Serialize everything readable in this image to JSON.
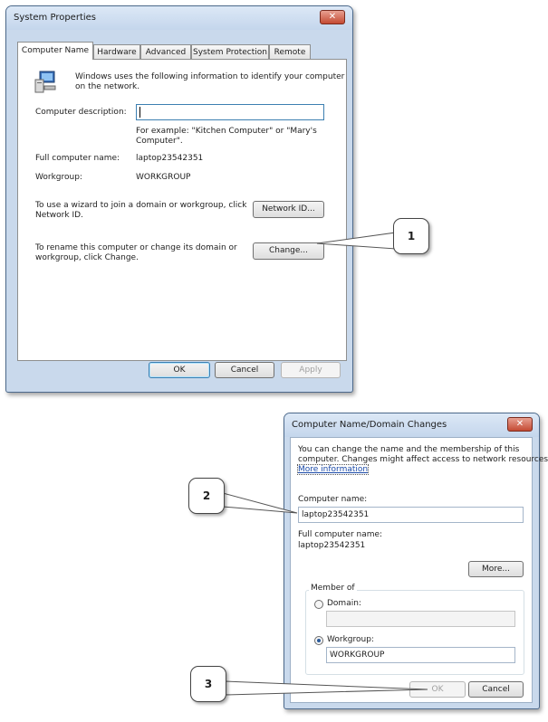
{
  "system_properties": {
    "title": "System Properties",
    "close_glyph": "✕",
    "tabs": [
      "Computer Name",
      "Hardware",
      "Advanced",
      "System Protection",
      "Remote"
    ],
    "intro_line1": "Windows uses the following information to identify your computer",
    "intro_line2": "on the network.",
    "desc_label": "Computer description:",
    "desc_value": "",
    "example_line1": "For example: \"Kitchen Computer\" or \"Mary's",
    "example_line2": "Computer\".",
    "full_name_label": "Full computer name:",
    "full_name_value": "laptop23542351",
    "workgroup_label": "Workgroup:",
    "workgroup_value": "WORKGROUP",
    "networkid_text_line1": "To use a wizard to join a domain or workgroup, click",
    "networkid_text_line2": "Network ID.",
    "networkid_button": "Network ID...",
    "rename_text_line1": "To rename this computer or change its domain or",
    "rename_text_line2": "workgroup, click Change.",
    "change_button": "Change...",
    "ok_button": "OK",
    "cancel_button": "Cancel",
    "apply_button": "Apply"
  },
  "name_changes": {
    "title": "Computer Name/Domain Changes",
    "close_glyph": "✕",
    "intro_line1": "You can change the name and the membership of this",
    "intro_line2": "computer. Changes might affect access to network resources.",
    "more_info_link": "More information",
    "computer_name_label": "Computer name:",
    "computer_name_value": "laptop23542351",
    "full_name_label": "Full computer name:",
    "full_name_value": "laptop23542351",
    "more_button": "More...",
    "member_of_label": "Member of",
    "domain_label": "Domain:",
    "domain_value": "",
    "workgroup_label": "Workgroup:",
    "workgroup_value": "WORKGROUP",
    "ok_button": "OK",
    "cancel_button": "Cancel"
  },
  "callouts": [
    "1",
    "2",
    "3"
  ],
  "colors": {
    "title_bar": "#c9d9ec",
    "close_red": "#c44a33",
    "link_blue": "#1b4aa8"
  }
}
